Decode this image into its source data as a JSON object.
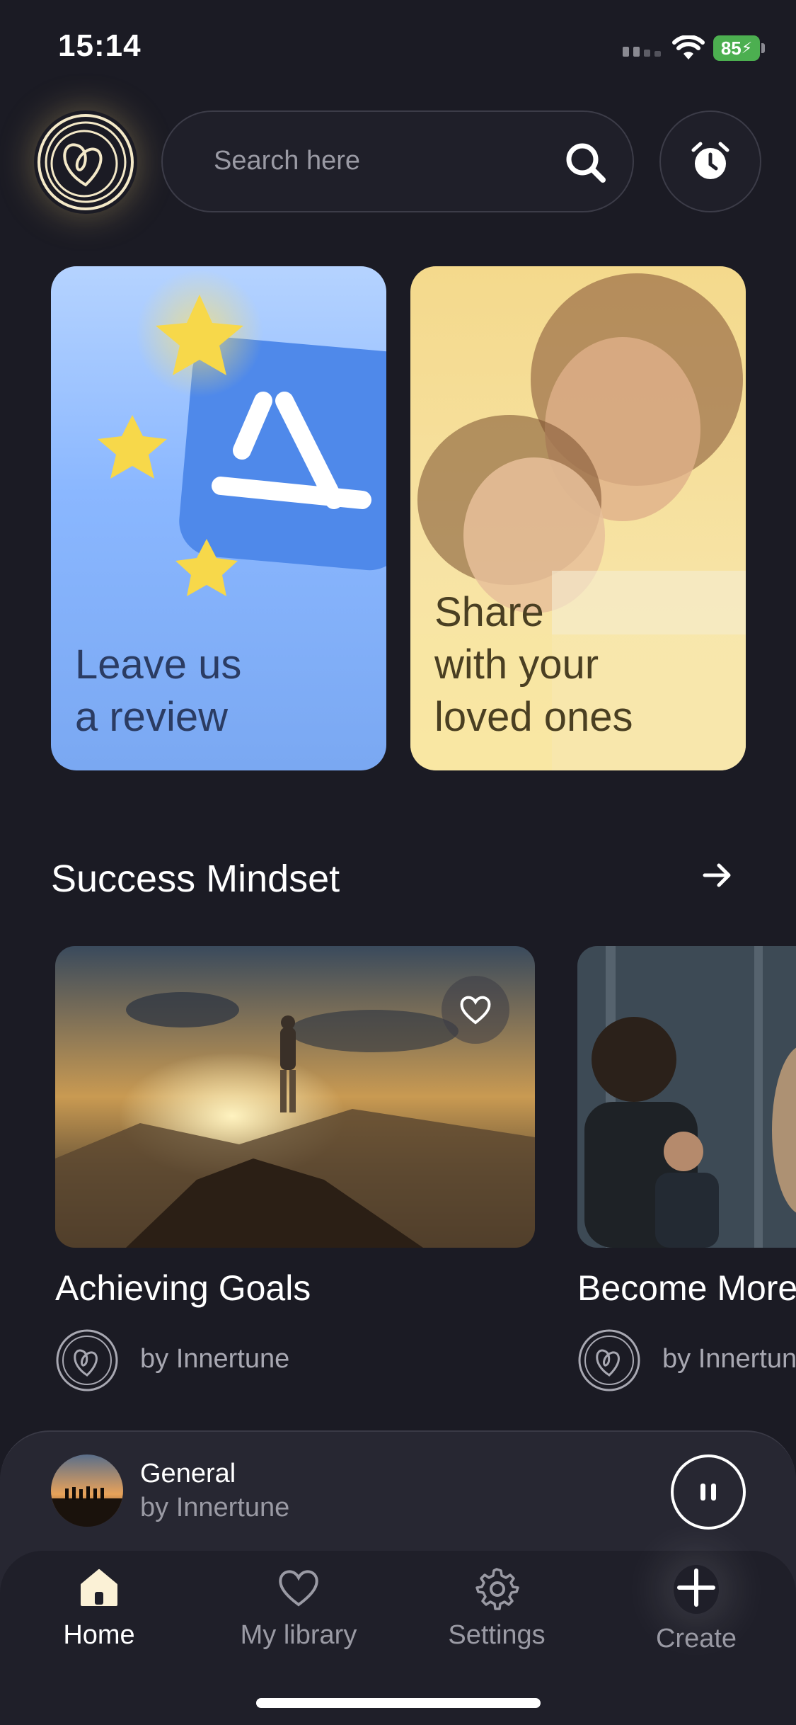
{
  "status_bar": {
    "time": "15:14",
    "battery": "85"
  },
  "header": {
    "search_placeholder": "Search here"
  },
  "promo_cards": [
    {
      "line1": "Leave us",
      "line2": "a review"
    },
    {
      "line1": "Share",
      "line2": "with your",
      "line3": "loved ones"
    }
  ],
  "section": {
    "title": "Success Mindset"
  },
  "tracks": [
    {
      "title": "Achieving Goals",
      "author": "by Innertune"
    },
    {
      "title": "Become More",
      "author": "by Innertune"
    }
  ],
  "player": {
    "title": "General",
    "author": "by Innertune"
  },
  "tabs": [
    {
      "label": "Home"
    },
    {
      "label": "My library"
    },
    {
      "label": "Settings"
    },
    {
      "label": "Create"
    }
  ],
  "colors": {
    "background": "#1b1b24",
    "accent_blue": "#8ab7ff",
    "accent_yellow": "#f7e3a4",
    "battery": "#4caf50"
  }
}
